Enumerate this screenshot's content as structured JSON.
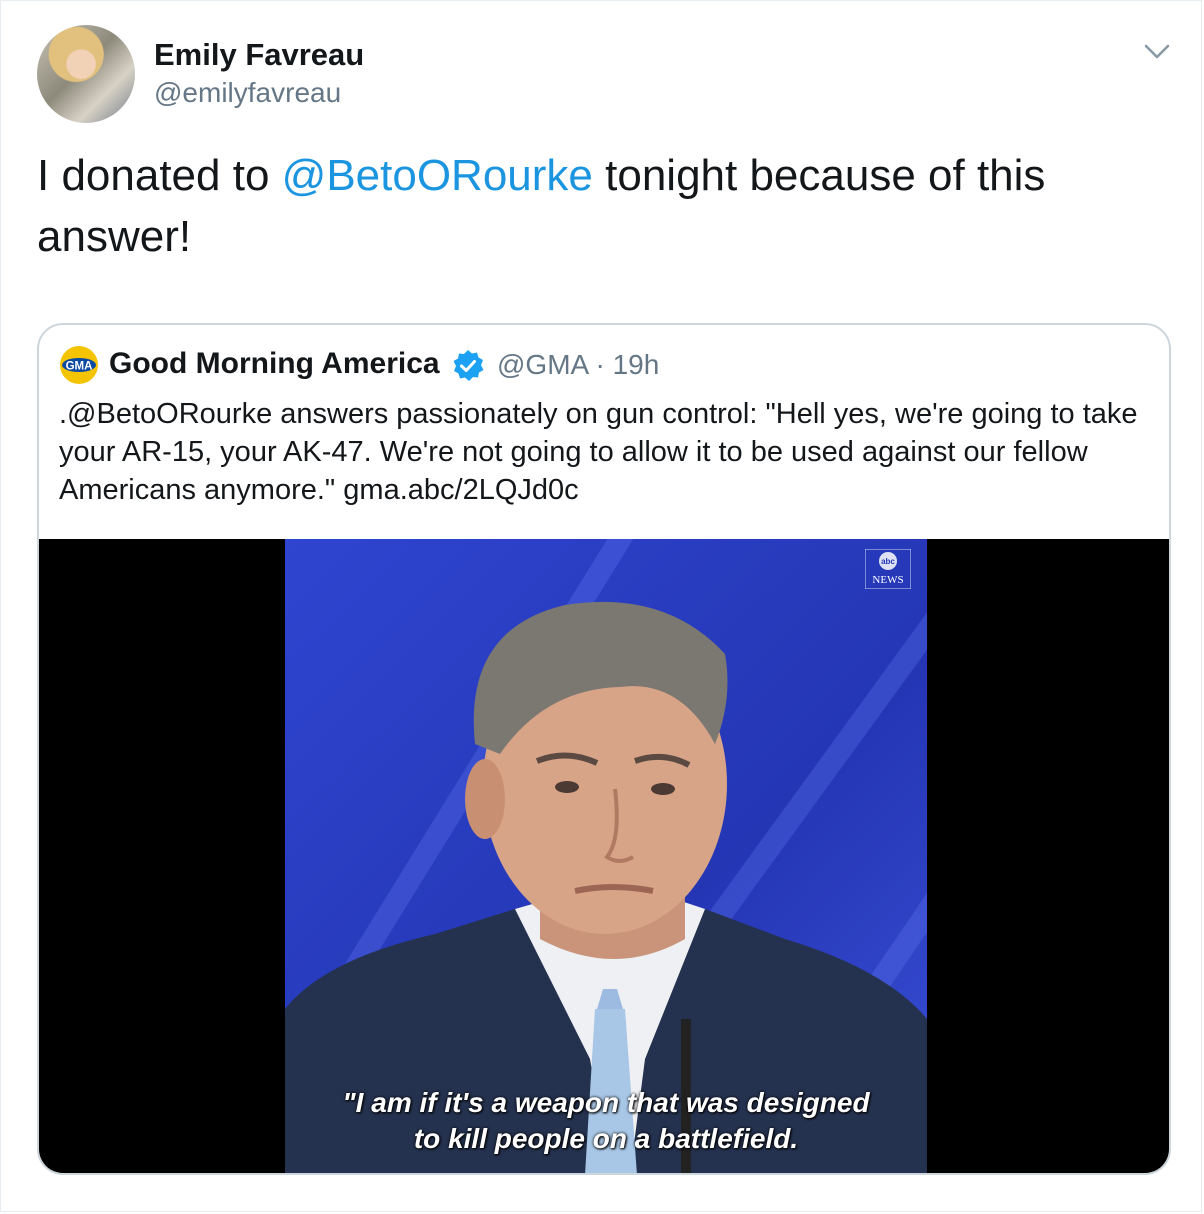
{
  "tweet": {
    "author_name": "Emily Favreau",
    "author_handle": "@emilyfavreau",
    "text_before": "I donated to ",
    "mention": "@BetoORourke",
    "text_after": " tonight because of this answer!"
  },
  "quoted_tweet": {
    "logo_text": "GMA",
    "name": "Good Morning America",
    "handle": "@GMA",
    "separator": "·",
    "time": "19h",
    "text": ".@BetoORourke answers passionately on gun control: \"Hell yes, we're going to take your AR-15, your AK-47. We're not going to allow it to be used against our fellow Americans anymore.\" gma.abc/2LQJd0c",
    "video": {
      "network_logo_top": "abc",
      "network_logo_bottom": "NEWS",
      "caption_line1": "\"I am if it's a weapon that was designed",
      "caption_line2": "to kill people on a battlefield."
    }
  },
  "colors": {
    "link": "#1b95e0",
    "secondary_text": "#657786",
    "verified": "#1da1f2",
    "border": "#ccd6dd",
    "stage_blue": "#2a3fc4"
  },
  "icons": {
    "menu": "chevron-down-icon",
    "verified": "verified-badge-icon"
  }
}
